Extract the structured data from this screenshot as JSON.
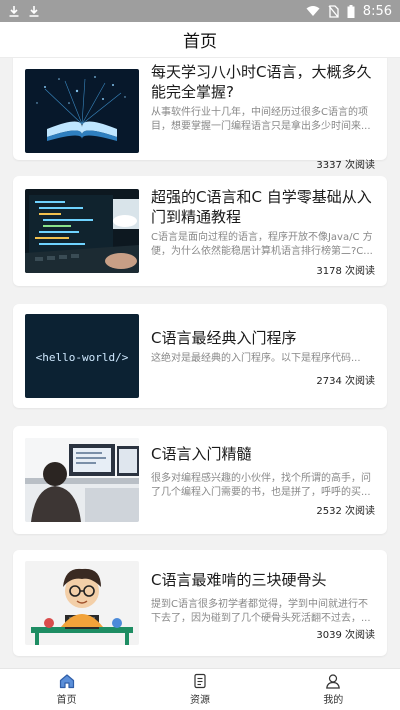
{
  "status_bar": {
    "time": "8:56",
    "icons": [
      "download-icon",
      "download-icon",
      "wifi-icon",
      "no-sim-icon",
      "battery-icon"
    ]
  },
  "header": {
    "title": "首页"
  },
  "articles": [
    {
      "title": "每天学习八小时C语言，大概多久能完全掌握?",
      "desc": "从事软件行业十几年，中间经历过很多C语言的项目，想要掌握一门编程语言只是拿出多少时间来...",
      "reads": "3337 次阅读",
      "image": "glowing-book-image"
    },
    {
      "title": "超强的C语言和C 自学零基础从入门到精通教程",
      "desc": "C语言是面向过程的语言，程序开放不像Java/C 方便，为什么依然能稳居计算机语言排行榜第二?C...",
      "reads": "3178 次阅读",
      "image": "laptop-code-image"
    },
    {
      "title": "C语言最经典入门程序",
      "desc": "这绝对是最经典的入门程序。以下是程序代码...",
      "reads": "2734 次阅读",
      "image": "hello-world-image",
      "image_text": "<hello-world/>"
    },
    {
      "title": "C语言入门精髓",
      "desc": "很多对编程感兴趣的小伙伴，找个所谓的高手，问了几个编程入门需要的书，也是拼了，呼呼的买...",
      "reads": "2532 次阅读",
      "image": "person-at-monitors-image"
    },
    {
      "title": "C语言最难啃的三块硬骨头",
      "desc": "提到C语言很多初学者都觉得，学到中间就进行不下去了，因为碰到了几个硬骨头死活翻不过去，...",
      "reads": "3039 次阅读",
      "image": "cartoon-boy-laptop-image"
    }
  ],
  "tabs": [
    {
      "label": "首页",
      "icon": "home-icon",
      "active": true
    },
    {
      "label": "资源",
      "icon": "document-icon",
      "active": false
    },
    {
      "label": "我的",
      "icon": "user-icon",
      "active": false
    }
  ],
  "colors": {
    "accent": "#3a7bd5",
    "status_bar": "#9e9e9e",
    "background": "#f2f2f2"
  }
}
